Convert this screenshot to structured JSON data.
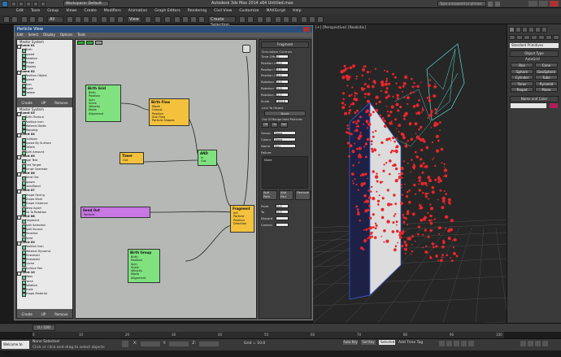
{
  "app": {
    "title": "Autodesk 3ds Max 2014 x64",
    "file": "Untitled.max",
    "workspace": "Workspace: Default",
    "search_placeholder": "Type a keyword or phrase"
  },
  "menus": [
    "Edit",
    "Tools",
    "Group",
    "Views",
    "Create",
    "Modifiers",
    "Animation",
    "Graph Editors",
    "Rendering",
    "Civil View",
    "Customize",
    "MAXScript",
    "Help"
  ],
  "toolbar": {
    "selection_filter": "All",
    "ref_coord": "View",
    "named_sel": "Create Selection Set"
  },
  "pf_window": {
    "title": "Particle View",
    "menus": [
      "Edit",
      "Select",
      "Display",
      "Options",
      "Tools"
    ],
    "depot_header": "Master System",
    "depot_buttons": [
      "Create",
      "UP",
      "Remove"
    ],
    "depot_groups": [
      {
        "name": "Event 01",
        "items": [
          "Birth",
          "Speed",
          "Rotation",
          "Shape",
          "Display"
        ]
      },
      {
        "name": "Event 02",
        "items": [
          "Position Object",
          "Speed",
          "Spin",
          "Scale",
          "Delete"
        ]
      },
      {
        "name": "Event 03",
        "items": [
          "Birth Texture",
          "Position Icon",
          "Material Static",
          "Mapping"
        ]
      },
      {
        "name": "Event 04",
        "items": [
          "Collision",
          "Speed By Surface",
          "Delete",
          "Split Amount"
        ]
      },
      {
        "name": "Event 05",
        "items": [
          "Age Test",
          "Find Target",
          "Script Operator"
        ]
      },
      {
        "name": "Event 06",
        "items": [
          "Send Out",
          "Spawn",
          "Lock/Bond"
        ]
      },
      {
        "name": "Event 07",
        "items": [
          "Shape Facing",
          "Shape Mark",
          "Shape Instance",
          "Keep Apart",
          "Go To Rotation"
        ]
      },
      {
        "name": "Event 08",
        "items": [
          "Fragment",
          "Split Selected",
          "Split Source",
          "Timeline",
          "Rand"
        ]
      },
      {
        "name": "Event 09",
        "items": [
          "Position Icon",
          "Material Dynamic",
          "Threshold",
          "Threshold",
          "Cache",
          "Surface Pos"
        ]
      },
      {
        "name": "Event 10",
        "items": [
          "Mass",
          "Force",
          "Rotation",
          "Scale",
          "Shape Material"
        ]
      }
    ],
    "nodes": {
      "n1": {
        "title": "Birth Grid",
        "ops": [
          "Birth",
          "Position",
          "Spin",
          "Scale",
          "Velocity",
          "Mode",
          "Alignment"
        ]
      },
      "n2": {
        "title": "Birth Flow",
        "ops": [
          "Mode",
          "Output",
          "Position",
          "Sub Flow",
          "Particle Shapes"
        ]
      },
      "n3": {
        "title": "Timer",
        "ops": [
          "Out"
        ]
      },
      "n4": {
        "title": "AND",
        "ops": [
          "In",
          "Out"
        ]
      },
      "n5": {
        "title": "Send Out",
        "ops": [
          "Particle"
        ]
      },
      "n6": {
        "title": "Birth Group",
        "ops": [
          "Birth",
          "Position",
          "Spin",
          "Scale",
          "Velocity",
          "Mode",
          "Alignment"
        ]
      },
      "n7": {
        "title": "Fragment",
        "ops": [
          "Init",
          "Particle",
          "Position",
          "Direction"
        ]
      }
    },
    "params": {
      "header": "Fragment",
      "sub": "Simulation Controls",
      "rows": [
        {
          "label": "Time Offset",
          "value": "0"
        },
        {
          "label": "Position X",
          "value": "0.0"
        },
        {
          "label": "Position Y",
          "value": "0.0"
        },
        {
          "label": "Position Z",
          "value": "0.0"
        },
        {
          "label": "Rotation X",
          "value": "0.0"
        },
        {
          "label": "Rotation Y",
          "value": "0.0"
        },
        {
          "label": "Rotation Z",
          "value": "0.0"
        },
        {
          "label": "Scale",
          "value": "100.0"
        }
      ],
      "link_label": "Link To Object",
      "link_value": "None",
      "out_label": "Out Of Range Hold Particles",
      "tabs": [
        "Off",
        "On",
        "Ref"
      ],
      "dropdowns": [
        {
          "label": "Group",
          "value": "None"
        },
        {
          "label": "Colour",
          "value": "None"
        },
        {
          "label": "Name",
          "value": "Syn"
        }
      ],
      "failure_label": "Failure",
      "failure_value": "None",
      "buttons": [
        "Add Path",
        "Add Port",
        "Remove"
      ],
      "bottom": [
        {
          "label": "From",
          "value": "0.0"
        },
        {
          "label": "To",
          "value": "0.0"
        },
        {
          "label": "Discard",
          "value": ""
        },
        {
          "label": "Control",
          "value": ""
        }
      ]
    }
  },
  "viewport": {
    "label": "[+] [Perspective] [Realistic]"
  },
  "cmd_panel": {
    "dropdown": "Standard Primitives",
    "rollout": "Object Type",
    "autogrid": "AutoGrid",
    "buttons": [
      "Box",
      "Cone",
      "Sphere",
      "GeoSphere",
      "Cylinder",
      "Tube",
      "Torus",
      "Pyramid",
      "Teapot",
      "Plane"
    ],
    "name_rollout": "Name and Color"
  },
  "timeline": {
    "frame": "0 / 100",
    "ticks": [
      "0",
      "10",
      "20",
      "30",
      "40",
      "50",
      "60",
      "70",
      "80",
      "90",
      "100"
    ]
  },
  "status": {
    "selected": "None Selected",
    "prompt": "Click or click-and-drag to select objects",
    "welcome": "Welcome to MAX",
    "x": "X:",
    "y": "Y:",
    "z": "Z:",
    "grid": "Grid = 10.0",
    "autokey": "Auto Key",
    "setkey": "Set Key",
    "key_filter": "Selected",
    "add_time_tag": "Add Time Tag"
  },
  "colors": {
    "node_green": "#7fe27f",
    "node_yellow": "#f3c13c",
    "node_purple": "#c778e2",
    "particle_red": "#e8262b",
    "mesh_cyan": "#5ee0d6"
  }
}
